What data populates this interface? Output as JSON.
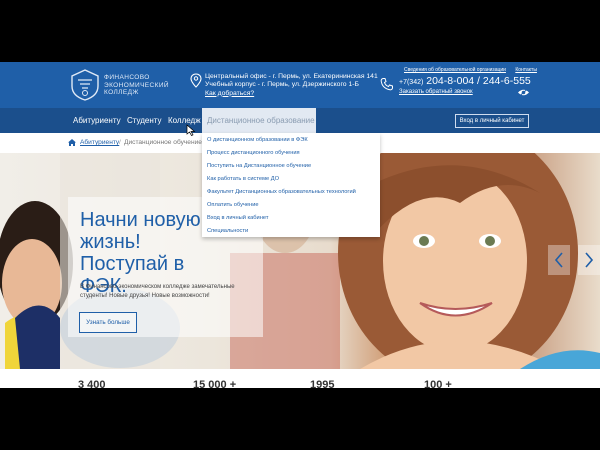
{
  "brand": {
    "logo_lines": [
      "ФИНАНСОВО",
      "ЭКОНОМИЧЕСКИЙ",
      "КОЛЛЕДЖ"
    ]
  },
  "contacts": {
    "address_line1": "Центральный офис - г. Пермь, ул. Екатерининская 141",
    "address_line2": "Учебный корпус - г. Пермь, ул. Дзержинского 1-Б",
    "directions_link": "Как добраться?",
    "top_link1": "Сведения об образовательной организации",
    "top_link2": "Контакты",
    "phone_prefix": "+7(342)",
    "phones": "204-8-004 / 244-6-555",
    "callback": "Заказать обратный звонок"
  },
  "nav": {
    "items": [
      "Абитуриенту",
      "Студенту",
      "Колледж"
    ],
    "active": "Дистанционное образование",
    "cabinet_button": "Вход в личный кабинет"
  },
  "breadcrumb": {
    "first": "Абитуриенту",
    "separator": "/",
    "current": "Дистанционное обучение"
  },
  "dropdown": {
    "items": [
      "О дистанционном образовании в ФЭК",
      "Процесс дистанционного обучения",
      "Поступить на Дистанционное обучение",
      "Как работать в системе ДО",
      "Факультет Дистанционных образовательных технологий",
      "Оплатить обучение",
      "Вход в личный кабинет",
      "Специальности"
    ]
  },
  "hero": {
    "title": "Начни новую жизнь! Поступай в ФЭК.",
    "text": "В Финансово-экономическом колледже замечательные студенты! Новые друзья! Новые возможности!",
    "button": "Узнать больше"
  },
  "stats": [
    "3 400",
    "15 000 +",
    "1995",
    "100 +"
  ],
  "colors": {
    "header_blue": "#1f5fa8",
    "nav_blue": "#1b4f8c",
    "active_tab_bg": "#e2e9f2"
  }
}
